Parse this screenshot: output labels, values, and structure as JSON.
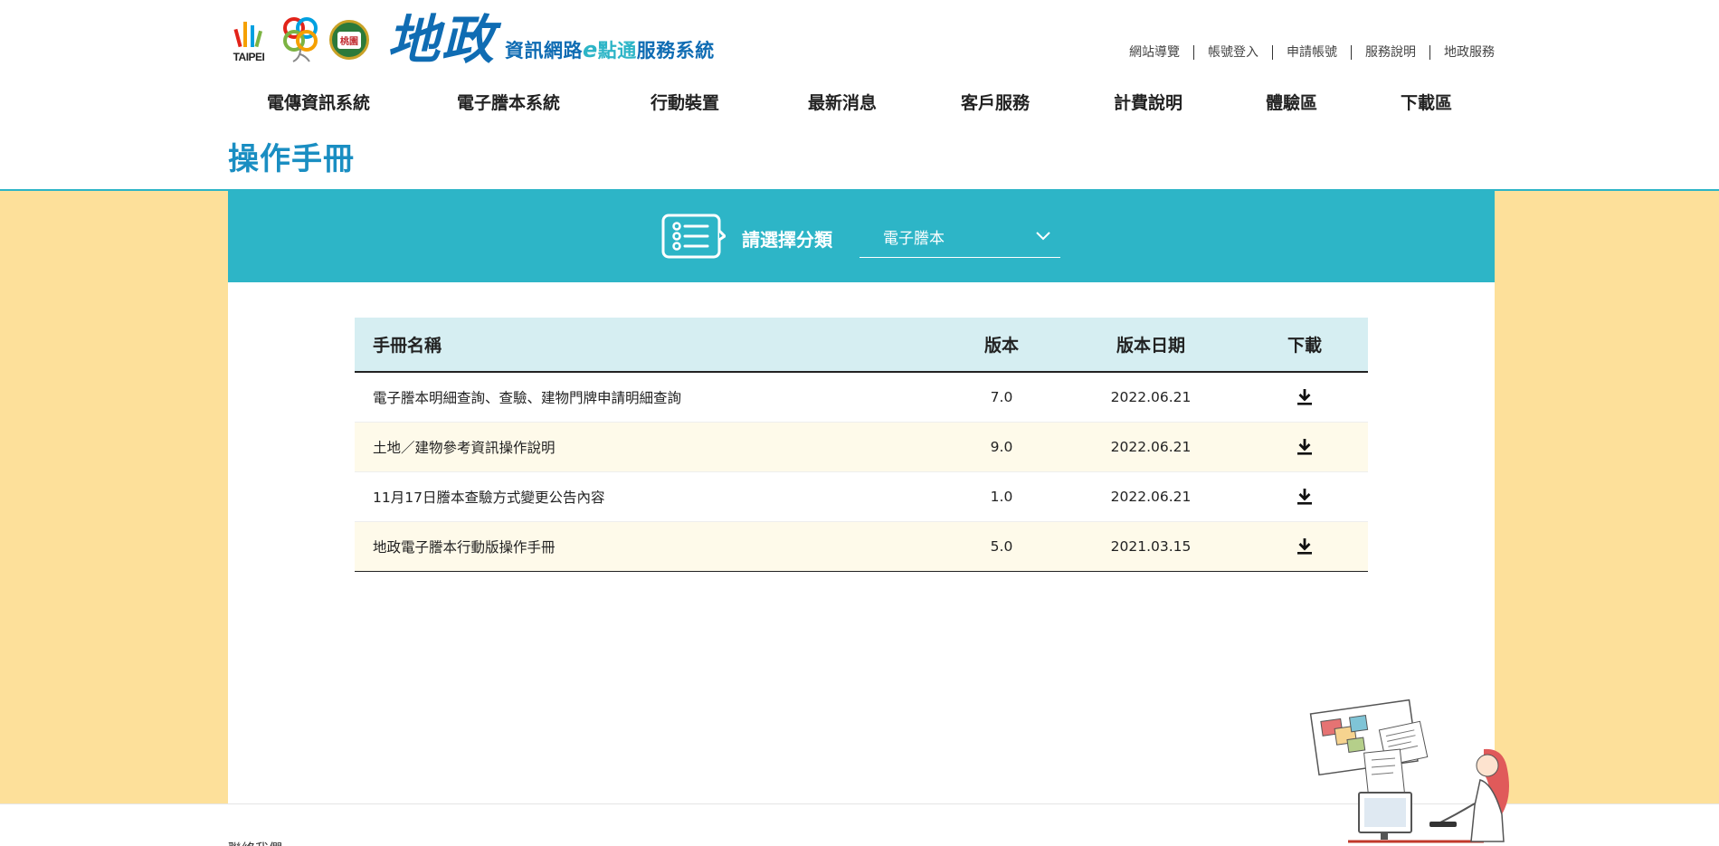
{
  "brand": {
    "taipei": "TAIPEI",
    "taoyuan": "桃園",
    "title": "地政",
    "subtitle_a": "資訊網路",
    "subtitle_e": "e",
    "subtitle_b": "點通",
    "subtitle_c": "服務系統"
  },
  "toplinks": [
    "網站導覽",
    "帳號登入",
    "申請帳號",
    "服務說明",
    "地政服務"
  ],
  "nav": [
    "電傳資訊系統",
    "電子謄本系統",
    "行動裝置",
    "最新消息",
    "客戶服務",
    "計費說明",
    "體驗區",
    "下載區"
  ],
  "page_title": "操作手冊",
  "filter": {
    "label": "請選擇分類",
    "selected": "電子謄本"
  },
  "table": {
    "headers": {
      "name": "手冊名稱",
      "version": "版本",
      "date": "版本日期",
      "download": "下載"
    },
    "rows": [
      {
        "name": "電子謄本明細查詢、查驗、建物門牌申請明細查詢",
        "version": "7.0",
        "date": "2022.06.21"
      },
      {
        "name": "土地／建物參考資訊操作說明",
        "version": "9.0",
        "date": "2022.06.21"
      },
      {
        "name": "11月17日謄本查驗方式變更公告內容",
        "version": "1.0",
        "date": "2022.06.21"
      },
      {
        "name": "地政電子謄本行動版操作手冊",
        "version": "5.0",
        "date": "2021.03.15"
      }
    ]
  },
  "footer": {
    "text": "聯絡我們"
  },
  "colors": {
    "accent": "#2db5c7",
    "brand_blue": "#0f6cb3",
    "title_blue": "#1a8ec2",
    "band": "#fde09a",
    "table_head": "#d6eef2",
    "row_alt": "#fefaea"
  }
}
